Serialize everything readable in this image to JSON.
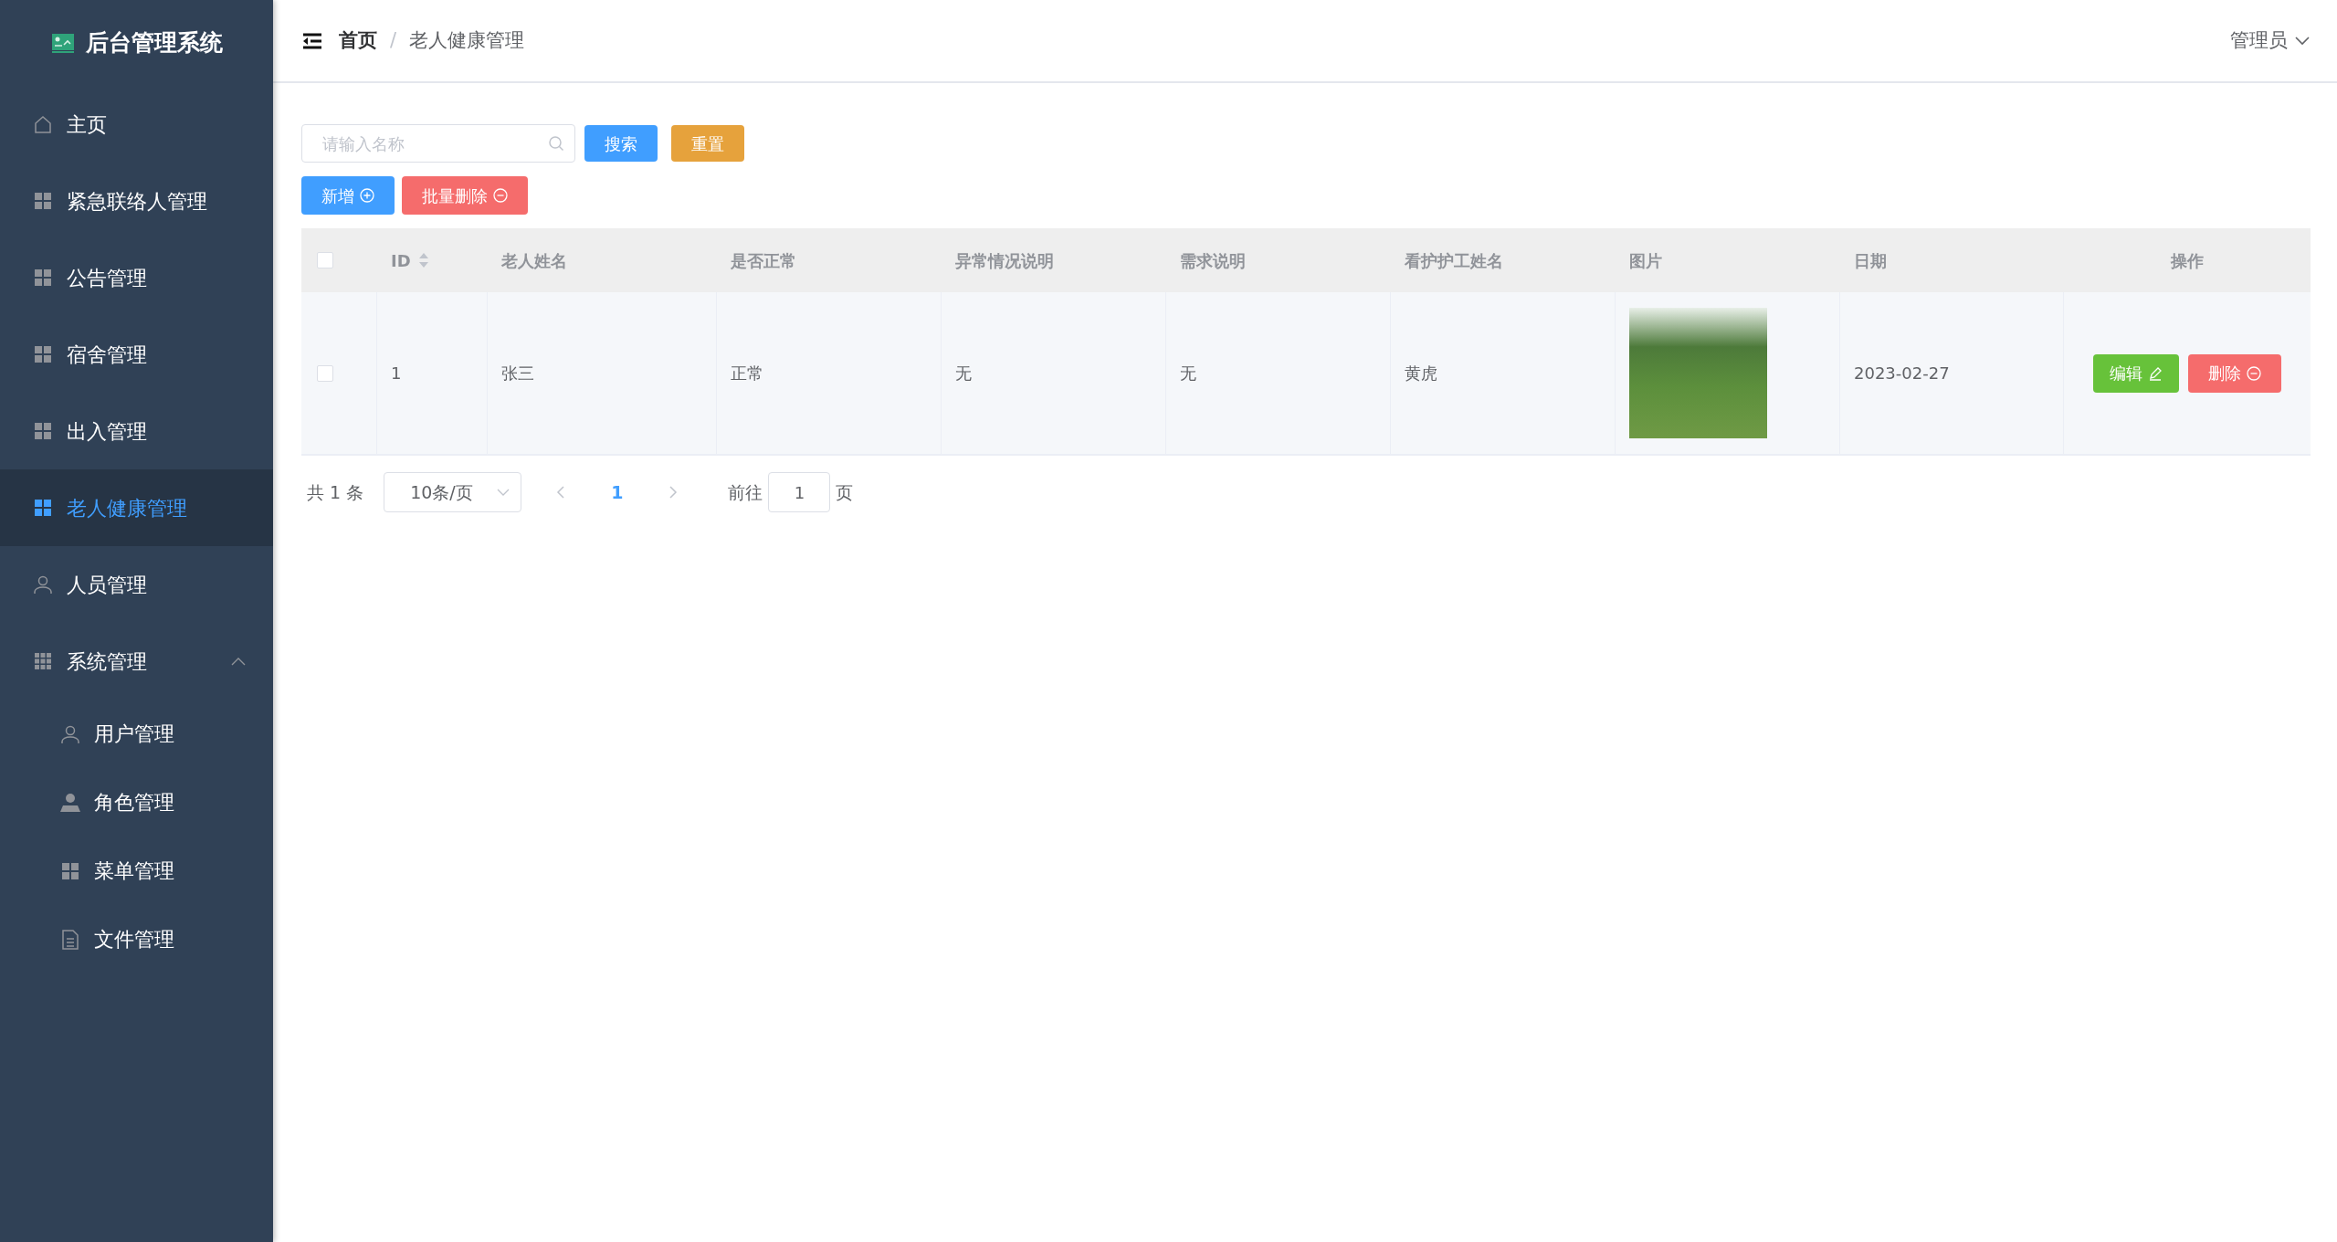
{
  "sidebar": {
    "title": "后台管理系统",
    "items": [
      {
        "label": "主页",
        "kind": "home",
        "selected": false
      },
      {
        "label": "紧急联络人管理",
        "kind": "grid",
        "selected": false
      },
      {
        "label": "公告管理",
        "kind": "grid",
        "selected": false
      },
      {
        "label": "宿舍管理",
        "kind": "grid",
        "selected": false
      },
      {
        "label": "出入管理",
        "kind": "grid",
        "selected": false
      },
      {
        "label": "老人健康管理",
        "kind": "grid",
        "selected": true
      },
      {
        "label": "人员管理",
        "kind": "user",
        "selected": false
      },
      {
        "label": "系统管理",
        "kind": "grid9",
        "selected": false,
        "expanded": true,
        "children": [
          {
            "label": "用户管理",
            "kind": "user",
            "selected": false
          },
          {
            "label": "角色管理",
            "kind": "userfill",
            "selected": false
          },
          {
            "label": "菜单管理",
            "kind": "grid",
            "selected": false
          },
          {
            "label": "文件管理",
            "kind": "doc",
            "selected": false
          }
        ]
      }
    ]
  },
  "header": {
    "breadcrumb": [
      "首页",
      "老人健康管理"
    ],
    "separator": "/",
    "user": "管理员"
  },
  "toolbar": {
    "search": {
      "placeholder": "请输入名称"
    },
    "search_button": "搜索",
    "reset_button": "重置",
    "add_button": "新增",
    "batch_delete_button": "批量删除"
  },
  "table": {
    "all_checked": false,
    "columns": [
      "ID",
      "老人姓名",
      "是否正常",
      "异常情况说明",
      "需求说明",
      "看护护工姓名",
      "图片",
      "日期",
      "操作"
    ],
    "rows": [
      {
        "checked": false,
        "id": "1",
        "name": "张三",
        "normal": "正常",
        "abnormal": "无",
        "needs": "无",
        "caregiver": "黄虎",
        "date": "2023-02-27",
        "edit": "编辑",
        "delete": "删除"
      }
    ]
  },
  "pagination": {
    "total": "共 1 条",
    "page_size": "10条/页",
    "pages": [
      {
        "label": "1",
        "selected": true
      }
    ],
    "goto_label": "前往",
    "goto_value": "1",
    "goto_suffix": "页"
  }
}
